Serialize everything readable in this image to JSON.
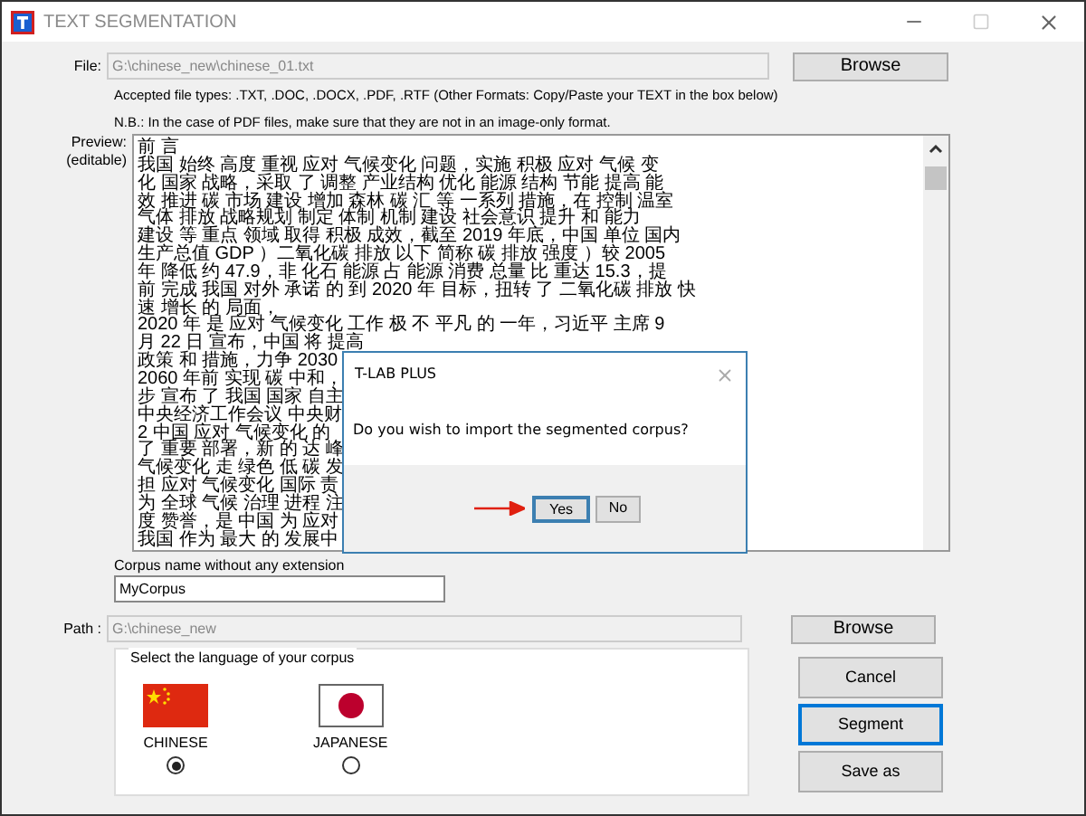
{
  "window": {
    "title": "TEXT SEGMENTATION"
  },
  "file": {
    "label": "File:",
    "value": "G:\\chinese_new\\chinese_01.txt",
    "button": "Browse"
  },
  "notes": [
    "Accepted file types: .TXT, .DOC, .DOCX, .PDF, .RTF (Other Formats: Copy/Paste your TEXT in the box below)",
    "N.B.: In the case of PDF files, make sure that they are not in an image-only format."
  ],
  "preview": {
    "label": "Preview:",
    "sublabel": "(editable)",
    "lines": [
      "前 言",
      "我国 始终 高度 重视 应对 气候变化 问题，实施 积极 应对 气候 变",
      "化 国家 战略，采取 了 调整 产业结构 优化 能源 结构 节能 提高 能",
      "效 推进 碳 市场 建设 增加 森林 碳 汇 等 一系列 措施，在 控制 温室",
      "气体 排放 战略规划 制定 体制 机制 建设 社会意识 提升 和 能力",
      "建设 等 重点 领域 取得 积极 成效，截至 2019 年底，中国 单位 国内",
      "生产总值 GDP ）二氧化碳 排放 以下 简称 碳 排放 强度 ）较 2005",
      "年 降低 约 47.9，非 化石 能源 占 能源 消费 总量 比 重达 15.3，提",
      "前 完成 我国 对外 承诺 的 到 2020 年 目标，扭转 了 二氧化碳 排放 快",
      "速 增长 的 局面，",
      "2020 年 是 应对 气候变化 工作 极 不 平凡 的 一年，习近平 主席 9",
      "月 22 日 宣布，中国 将 提高",
      "政策 和 措施，力争 2030",
      "2060 年前 实现 碳 中和，",
      "步 宣布 了 我国 国家 自主",
      "中央经济工作会议 中央财",
      "2 中国 应对 气候变化 的",
      "了 重要 部署，新 的 达 峰",
      "气候变化 走 绿色 低 碳 发",
      "担 应对 气候变化 国际 责",
      "为 全球 气候 治理 进程 注",
      "度 赞誉，是 中国 为 应对",
      "我国 作为 最大 的 发展中"
    ]
  },
  "corpus_name": {
    "label": "Corpus name without any extension",
    "value": "MyCorpus"
  },
  "path": {
    "label": "Path :",
    "value": "G:\\chinese_new",
    "button": "Browse"
  },
  "language_group": {
    "title": "Select the language of your corpus",
    "languages": [
      {
        "name": "CHINESE",
        "kind": "china",
        "selected": true
      },
      {
        "name": "JAPANESE",
        "kind": "japan",
        "selected": false
      }
    ]
  },
  "buttons": [
    {
      "label": "Cancel",
      "focused": false
    },
    {
      "label": "Segment",
      "focused": true
    },
    {
      "label": "Save as",
      "focused": false
    }
  ],
  "dialog": {
    "title": "T-LAB PLUS",
    "message": "Do you wish to import the segmented corpus?",
    "buttons": [
      {
        "label": "Yes",
        "default": true
      },
      {
        "label": "No",
        "default": false
      }
    ]
  }
}
